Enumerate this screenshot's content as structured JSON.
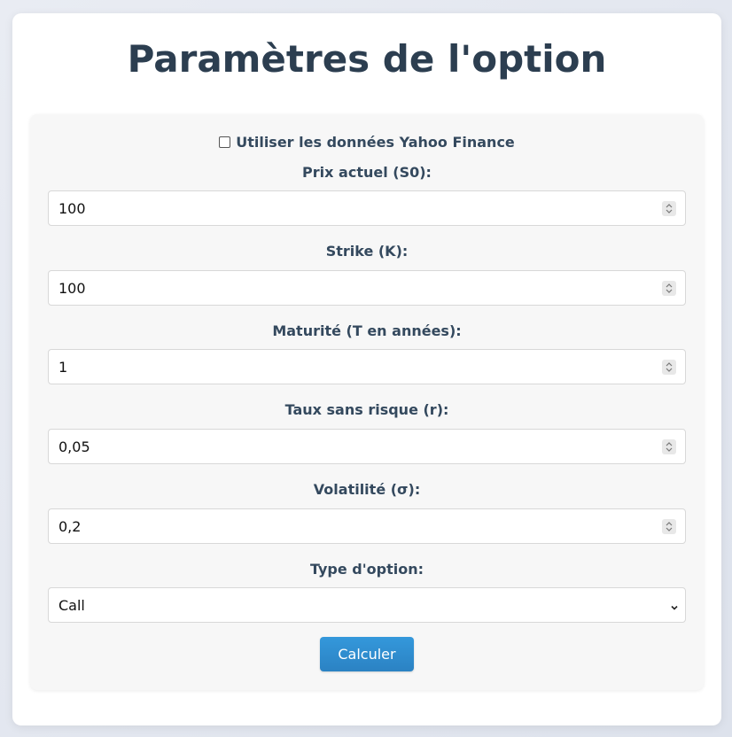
{
  "title": "Paramètres de l'option",
  "yahoo_checkbox": {
    "label": "Utiliser les données Yahoo Finance",
    "checked": false
  },
  "fields": [
    {
      "label": "Prix actuel (S0):",
      "value": "100",
      "icon": "spinner-icon"
    },
    {
      "label": "Strike (K):",
      "value": "100",
      "icon": "spinner-icon"
    },
    {
      "label": "Maturité (T en années):",
      "value": "1",
      "icon": "spinner-icon"
    },
    {
      "label": "Taux sans risque (r):",
      "value": "0,05",
      "icon": "spinner-icon"
    },
    {
      "label": "Volatilité (σ):",
      "value": "0,2",
      "icon": "spinner-icon"
    }
  ],
  "option_type": {
    "label": "Type d'option:",
    "selected": "Call",
    "icon": "chevron-down-icon"
  },
  "submit": {
    "label": "Calculer"
  },
  "colors": {
    "title": "#2c3e50",
    "label": "#34495e",
    "button": "#3498db"
  }
}
